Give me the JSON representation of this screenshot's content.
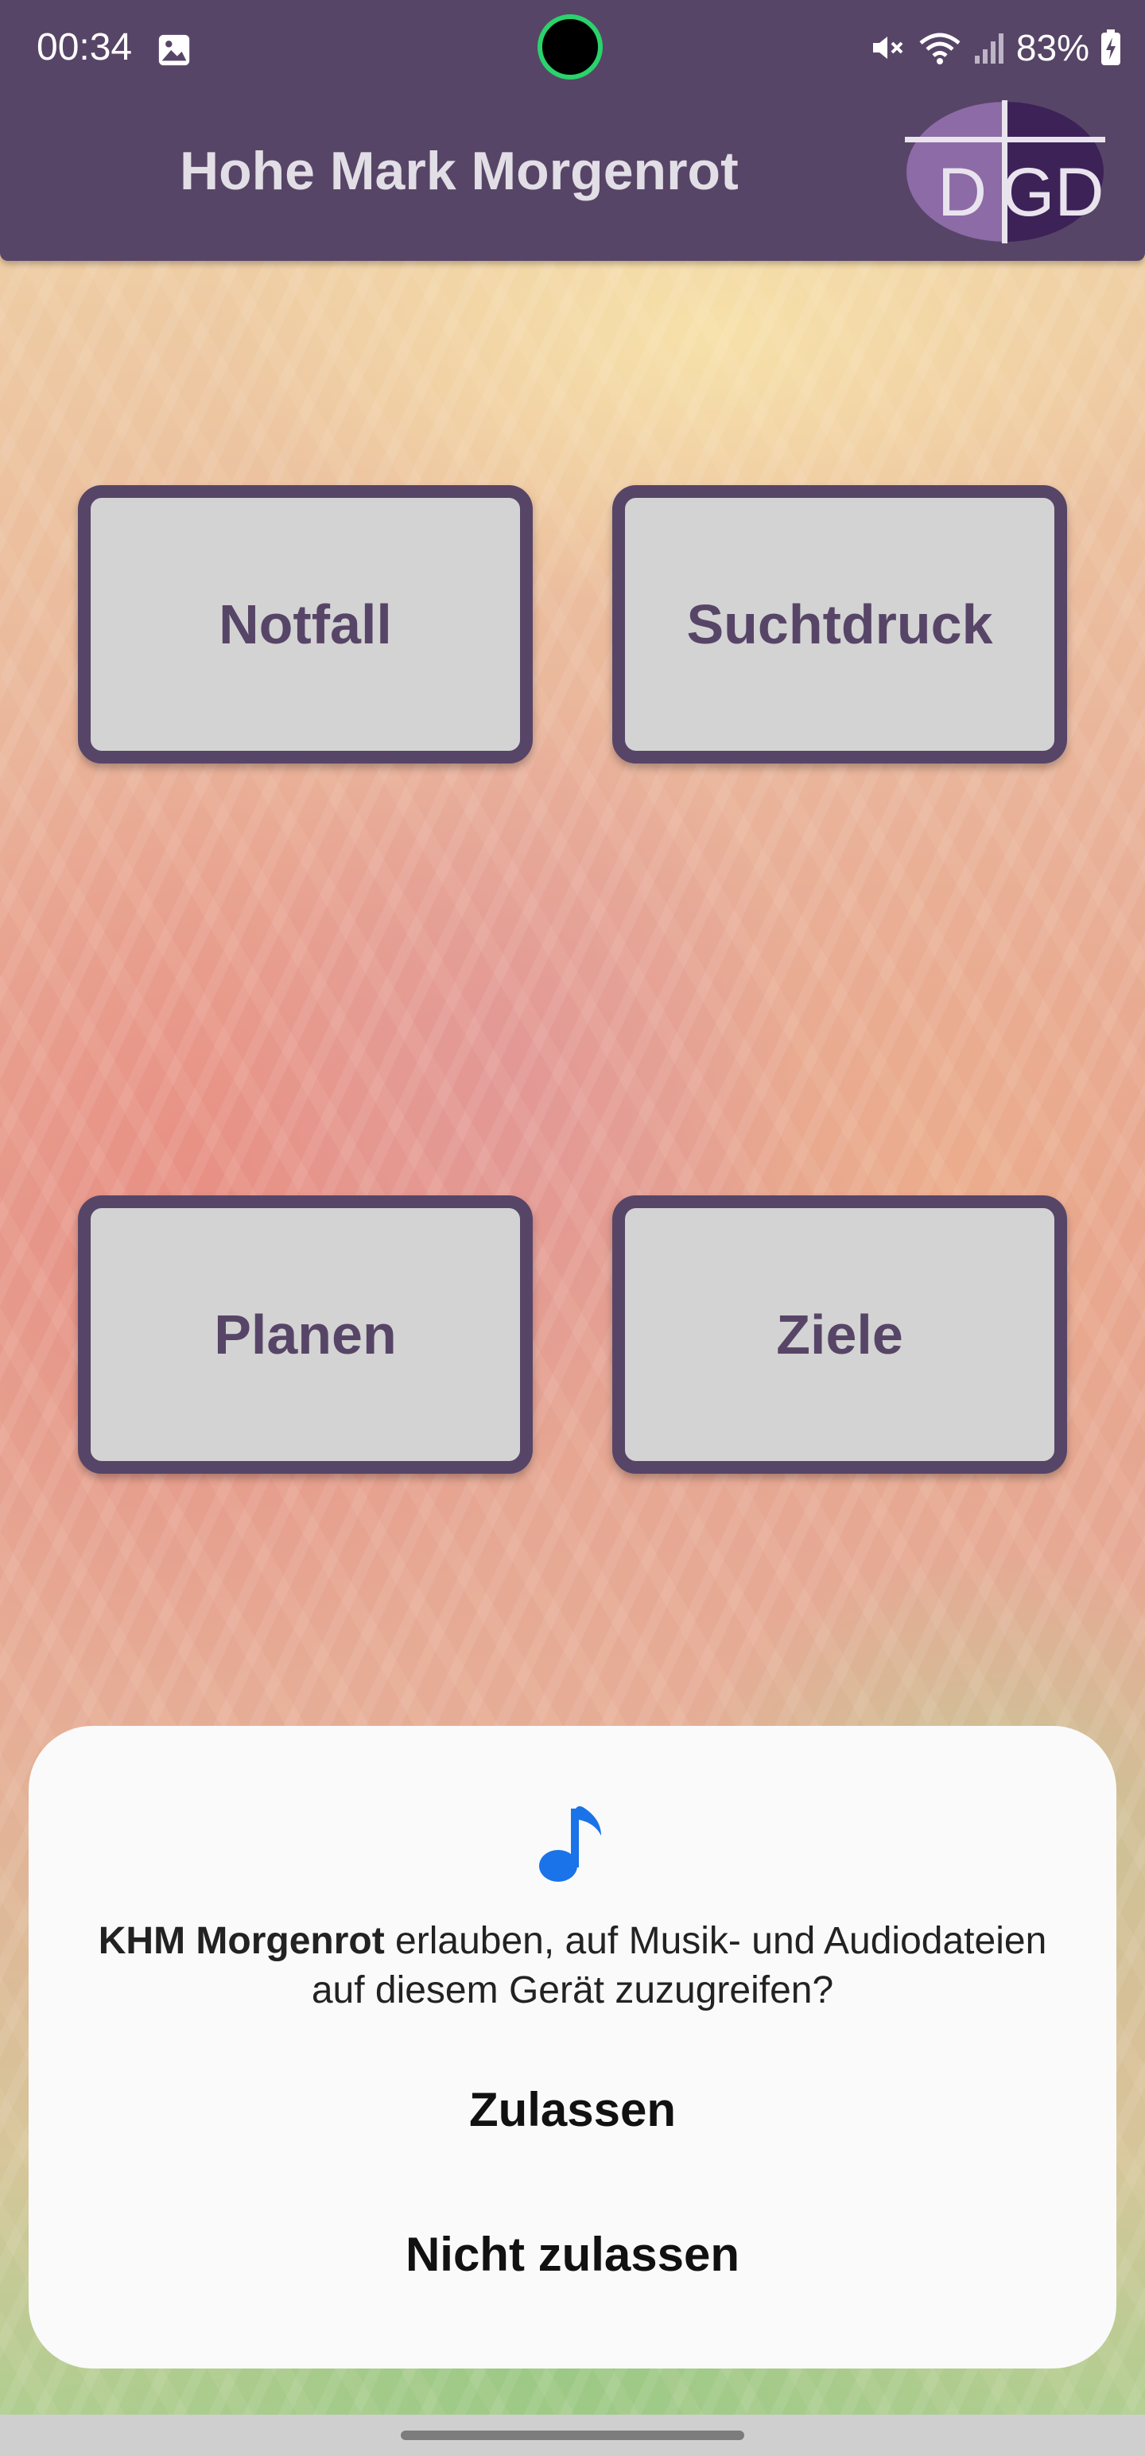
{
  "status_bar": {
    "time": "00:34",
    "battery": "83%",
    "icons": [
      "gallery-icon",
      "mute-icon",
      "wifi-icon",
      "signal-icon",
      "battery-charging-icon"
    ]
  },
  "app_bar": {
    "title": "Hohe Mark Morgenrot",
    "logo_text": "DGD",
    "color": "#574567"
  },
  "tiles": [
    {
      "label": "Notfall"
    },
    {
      "label": "Suchtdruck"
    },
    {
      "label": "Planen"
    },
    {
      "label": "Ziele"
    }
  ],
  "dialog": {
    "icon": "music-note-icon",
    "app_name": "KHM Morgenrot",
    "message": " erlauben, auf Musik- und Audiodateien auf diesem Gerät zuzugreifen?",
    "allow_label": "Zulassen",
    "deny_label": "Nicht zulassen",
    "accent": "#1a73e8"
  }
}
